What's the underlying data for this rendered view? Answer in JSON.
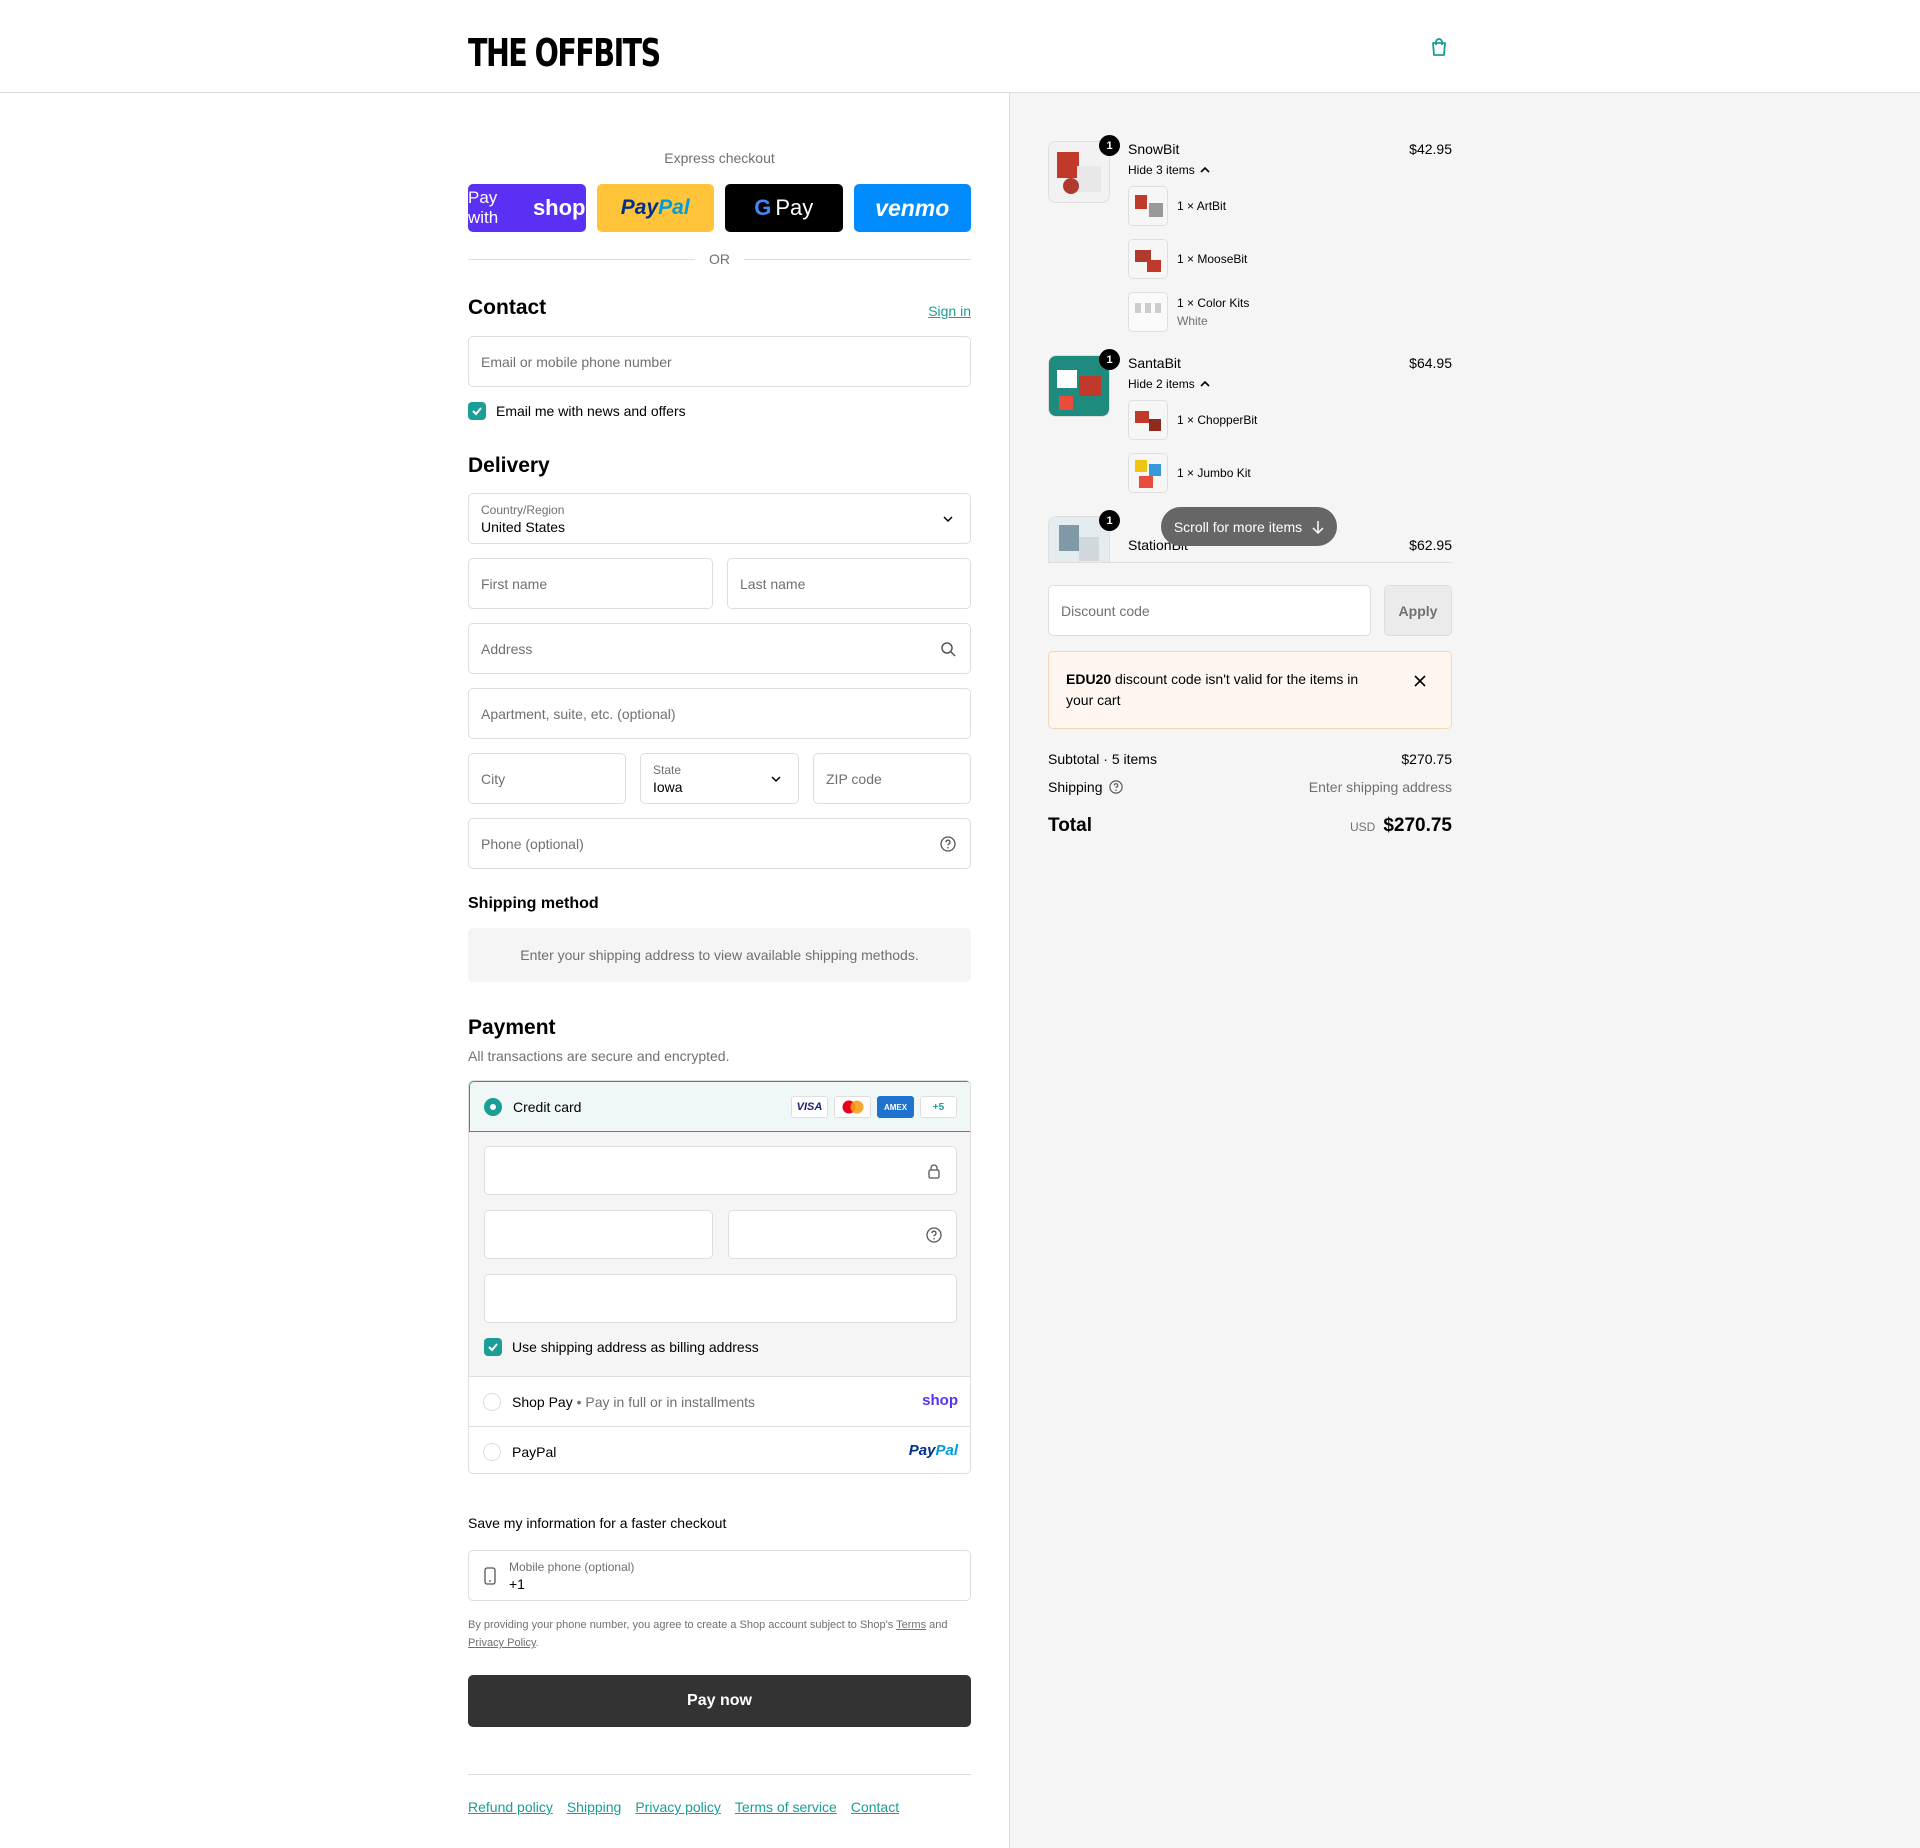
{
  "brand": {
    "logo_text": "THE OFFBITS"
  },
  "express": {
    "title": "Express checkout",
    "shop_pay_prefix": "Pay with",
    "shop_pay_brand": "shop",
    "paypal_a": "Pay",
    "paypal_b": "Pal",
    "gpay_g": "G",
    "gpay": "Pay",
    "venmo": "venmo",
    "or": "OR"
  },
  "contact": {
    "title": "Contact",
    "sign_in": "Sign in",
    "email_placeholder": "Email or mobile phone number",
    "news_label": "Email me with news and offers"
  },
  "delivery": {
    "title": "Delivery",
    "country_label": "Country/Region",
    "country_value": "United States",
    "first_name": "First name",
    "last_name": "Last name",
    "address": "Address",
    "apartment": "Apartment, suite, etc. (optional)",
    "city": "City",
    "state_label": "State",
    "state_value": "Iowa",
    "zip": "ZIP code",
    "phone": "Phone (optional)"
  },
  "shipping_method": {
    "title": "Shipping method",
    "note": "Enter your shipping address to view available shipping methods."
  },
  "payment": {
    "title": "Payment",
    "subtitle": "All transactions are secure and encrypted.",
    "credit_card": "Credit card",
    "card_brands": [
      "VISA",
      "AMEX",
      "+5"
    ],
    "billing_label": "Use shipping address as billing address",
    "shop_pay": "Shop Pay",
    "shop_pay_sub": "Pay in full or in installments",
    "shop_brand": "shop",
    "paypal": "PayPal",
    "paypal_brand_a": "Pay",
    "paypal_brand_b": "Pal"
  },
  "save_info": {
    "title": "Save my information for a faster checkout",
    "mobile_label": "Mobile phone (optional)",
    "mobile_value": "+1",
    "legal_a": "By providing your phone number, you agree to create a Shop account subject to Shop's",
    "terms": "Terms",
    "legal_and": "and",
    "privacy": "Privacy Policy",
    "legal_end": "."
  },
  "pay_now": "Pay now",
  "footer_links": [
    "Refund policy",
    "Shipping",
    "Privacy policy",
    "Terms of service",
    "Contact"
  ],
  "cart": {
    "items": [
      {
        "name": "SnowBit",
        "price": "$42.95",
        "qty": "1",
        "hide_label": "Hide 3 items",
        "sub": [
          {
            "label": "1 × ArtBit",
            "variant": ""
          },
          {
            "label": "1 × MooseBit",
            "variant": ""
          },
          {
            "label": "1 × Color Kits",
            "variant": "White"
          }
        ]
      },
      {
        "name": "SantaBit",
        "price": "$64.95",
        "qty": "1",
        "hide_label": "Hide 2 items",
        "sub": [
          {
            "label": "1 × ChopperBit",
            "variant": ""
          },
          {
            "label": "1 × Jumbo Kit",
            "variant": ""
          }
        ]
      },
      {
        "name": "StationBit",
        "price": "$62.95",
        "qty": "1"
      }
    ],
    "scroll_hint": "Scroll for more items",
    "discount_placeholder": "Discount code",
    "apply": "Apply",
    "error_code": "EDU20",
    "error_text": "discount code isn't valid for the items in your cart",
    "subtotal_label": "Subtotal · 5 items",
    "subtotal_value": "$270.75",
    "shipping_label": "Shipping",
    "shipping_value": "Enter shipping address",
    "total_label": "Total",
    "currency": "USD",
    "total_value": "$270.75"
  },
  "colors": {
    "accent": "#1a9e96",
    "shop_pay": "#5a31f4",
    "paypal_yellow": "#ffc439",
    "venmo": "#008cff",
    "pay_button": "#333333"
  }
}
